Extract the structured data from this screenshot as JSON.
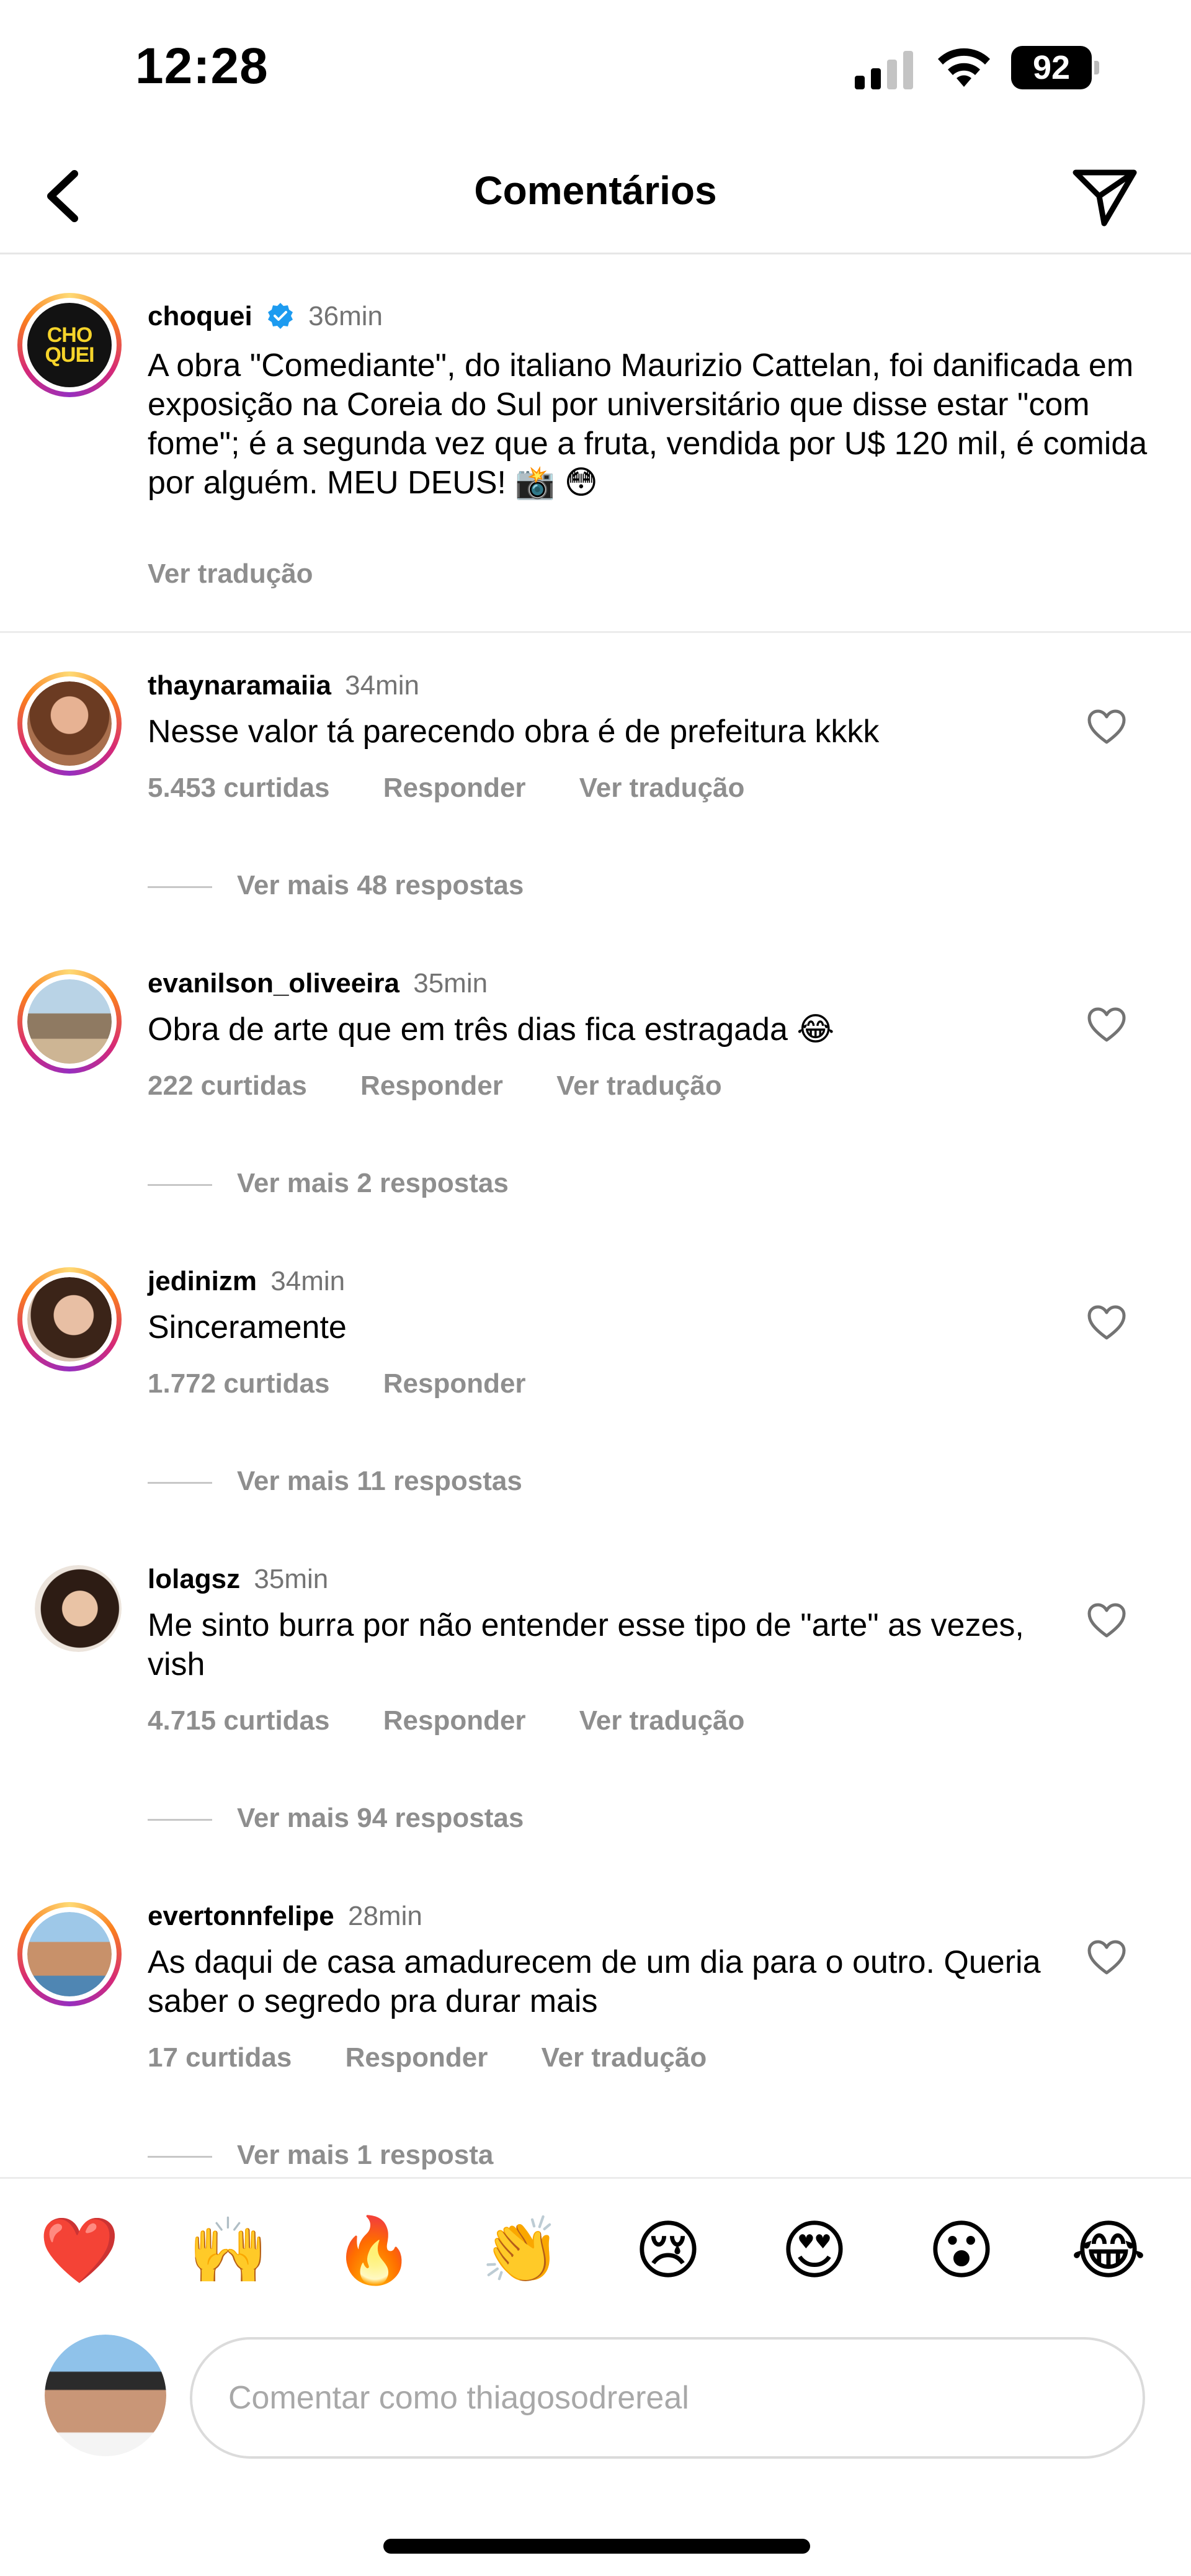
{
  "status_bar": {
    "time": "12:28",
    "battery": "92"
  },
  "header": {
    "title": "Comentários",
    "back_icon": "chevron-left-icon",
    "send_icon": "paper-plane-icon"
  },
  "caption": {
    "username": "choquei",
    "verified": true,
    "time": "36min",
    "avatar_text": [
      "CHO",
      "QUEI"
    ],
    "text": "A obra \"Comediante\", do italiano Maurizio Cattelan, foi danificada em exposição na Coreia do Sul por universitário que disse estar \"com fome\"; é a segunda vez que a fruta, vendida por U$ 120 mil, é comida por alguém. MEU DEUS! 📸 😳",
    "translate": "Ver tradução"
  },
  "comments": [
    {
      "username": "thaynaramaiia",
      "time": "34min",
      "text": "Nesse valor tá parecendo obra é de prefeitura kkkk",
      "likes": "5.453 curtidas",
      "reply": "Responder",
      "translate": "Ver tradução",
      "more_replies": "Ver mais 48 respostas"
    },
    {
      "username": "evanilson_oliveeira",
      "time": "35min",
      "text": "Obra de arte que em três dias fica estragada 😂",
      "likes": "222 curtidas",
      "reply": "Responder",
      "translate": "Ver tradução",
      "more_replies": "Ver mais 2 respostas"
    },
    {
      "username": "jedinizm",
      "time": "34min",
      "text": "Sinceramente",
      "likes": "1.772 curtidas",
      "reply": "Responder",
      "translate": "",
      "more_replies": "Ver mais 11 respostas"
    },
    {
      "username": "lolagsz",
      "time": "35min",
      "text": "Me sinto burra por não entender esse tipo de \"arte\" as vezes, vish",
      "likes": "4.715 curtidas",
      "reply": "Responder",
      "translate": "Ver tradução",
      "more_replies": "Ver mais 94 respostas"
    },
    {
      "username": "evertonnfelipe",
      "time": "28min",
      "text": "As daqui de casa amadurecem de um dia para o outro. Queria saber o segredo pra durar mais",
      "likes": "17 curtidas",
      "reply": "Responder",
      "translate": "Ver tradução",
      "more_replies": "Ver mais 1 resposta"
    }
  ],
  "emoji_bar": [
    "❤️",
    "🙌",
    "🔥",
    "👏",
    "😢",
    "😍",
    "😮",
    "😂"
  ],
  "comment_input": {
    "placeholder": "Comentar como thiagosodrereal"
  }
}
